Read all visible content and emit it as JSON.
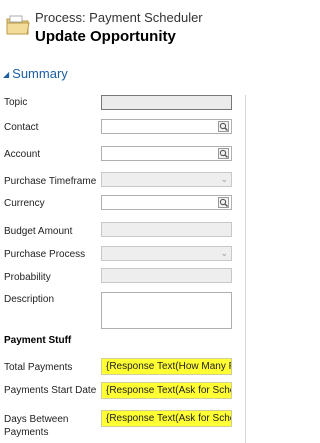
{
  "header": {
    "process_label": "Process: Payment Scheduler",
    "title": "Update Opportunity"
  },
  "summary": {
    "title": "Summary",
    "fields": [
      {
        "label": "Topic",
        "kind": "text",
        "value": ""
      },
      {
        "label": "Contact",
        "kind": "lookup",
        "value": ""
      },
      {
        "label": "Account",
        "kind": "lookup",
        "value": ""
      },
      {
        "label": "Purchase Timeframe",
        "kind": "select",
        "value": ""
      },
      {
        "label": "Currency",
        "kind": "lookup",
        "value": ""
      },
      {
        "label": "Budget Amount",
        "kind": "text",
        "value": ""
      },
      {
        "label": "Purchase Process",
        "kind": "select",
        "value": ""
      },
      {
        "label": "Probability",
        "kind": "text",
        "value": ""
      },
      {
        "label": "Description",
        "kind": "textarea",
        "value": ""
      }
    ]
  },
  "payment_stuff": {
    "title": "Payment Stuff",
    "fields": [
      {
        "label": "Total Payments",
        "value": "{Response Text(How Many Pa"
      },
      {
        "label": "Payments Start Date",
        "value": "{Response Text(Ask for Sched"
      },
      {
        "label": "Days Between Payments",
        "value": "{Response Text(Ask for Sched"
      }
    ]
  },
  "colors": {
    "accent": "#1c5fa5",
    "highlight": "#ffff33"
  }
}
